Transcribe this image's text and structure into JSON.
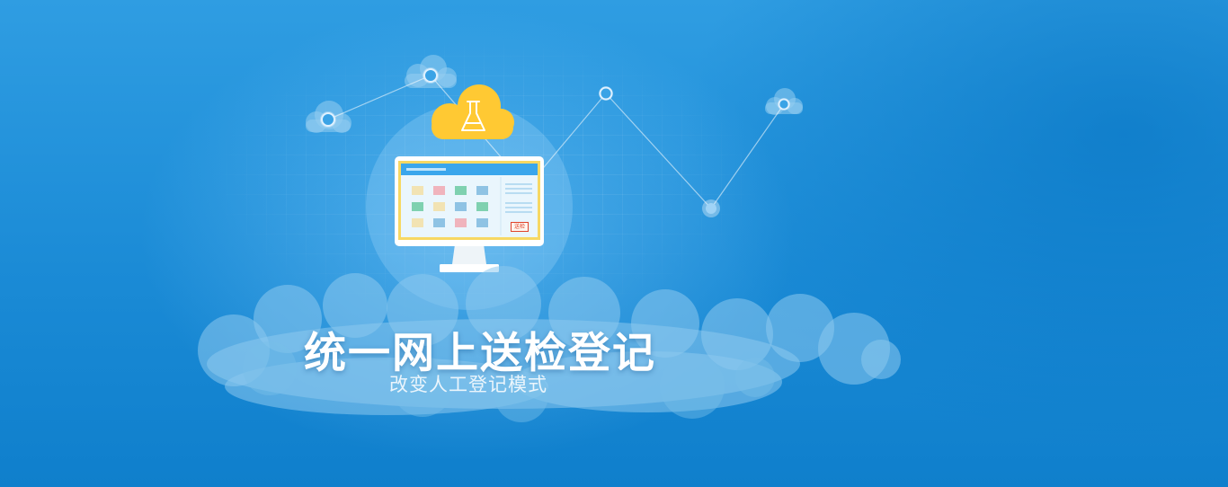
{
  "hero": {
    "title": "统一网上送检登记",
    "subtitle": "改变人工登记模式"
  },
  "monitor": {
    "button_label": "送检",
    "cell_colors": [
      "#f2e3b3",
      "#f0b4bd",
      "#7fd1b0",
      "#8fc3e4",
      "#7fd1b0",
      "#f2e3b3",
      "#8fc3e4",
      "#7fd1b0",
      "#f2e3b3",
      "#8fc3e4",
      "#f0b4bd",
      "#8fc3e4"
    ]
  },
  "icons": {
    "cloud_badge": "flask-icon"
  },
  "colors": {
    "background": "#1b8bd6",
    "cloud_badge": "#ffc933",
    "monitor_frame": "#f7d863",
    "screen_header": "#3aa6ec"
  }
}
